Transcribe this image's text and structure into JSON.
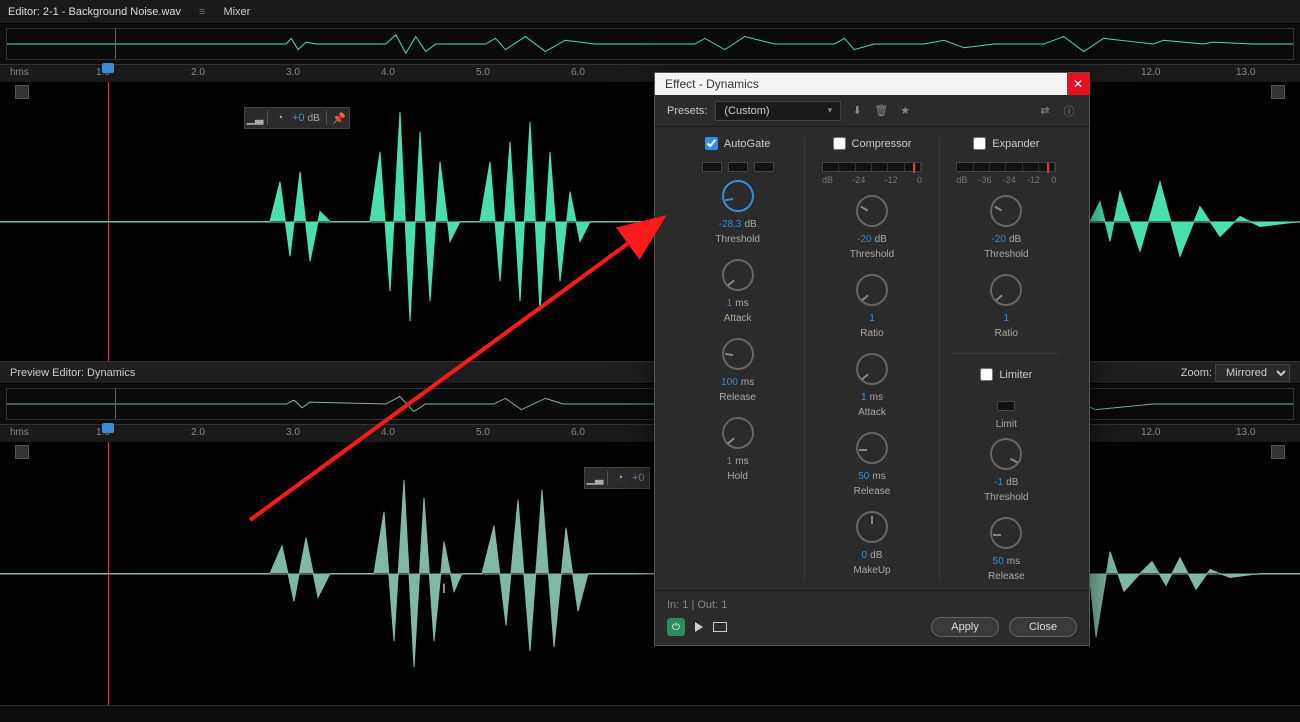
{
  "topbar": {
    "editor_label": "Editor: 2-1 - Background Noise.wav",
    "mixer_label": "Mixer"
  },
  "ruler_unit": "hms",
  "ruler_marks": [
    "1.0",
    "2.0",
    "3.0",
    "4.0",
    "5.0",
    "6.0",
    "12.0",
    "13.0"
  ],
  "gain": {
    "value": "+0",
    "unit": "dB"
  },
  "preview": {
    "title": "Preview Editor: Dynamics",
    "zoom_label": "Zoom:",
    "zoom_value": "Mirrored"
  },
  "dialog": {
    "title": "Effect - Dynamics",
    "presets_label": "Presets:",
    "presets_value": "(Custom)",
    "autogate": {
      "label": "AutoGate",
      "checked": true,
      "k1": {
        "val": "-28.3",
        "unit": "dB",
        "lbl": "Threshold"
      },
      "k2": {
        "val": "1",
        "unit": "ms",
        "lbl": "Attack"
      },
      "k3": {
        "val": "100",
        "unit": "ms",
        "lbl": "Release"
      },
      "k4": {
        "val": "1",
        "unit": "ms",
        "lbl": "Hold"
      }
    },
    "compressor": {
      "label": "Compressor",
      "checked": false,
      "scale": [
        "dB",
        "-24",
        "-12",
        "0"
      ],
      "k1": {
        "val": "-20",
        "unit": "dB",
        "lbl": "Threshold"
      },
      "k2": {
        "val": "1",
        "unit": "",
        "lbl": "Ratio"
      },
      "k3": {
        "val": "1",
        "unit": "ms",
        "lbl": "Attack"
      },
      "k4": {
        "val": "50",
        "unit": "ms",
        "lbl": "Release"
      },
      "k5": {
        "val": "0",
        "unit": "dB",
        "lbl": "MakeUp"
      }
    },
    "expander": {
      "label": "Expander",
      "checked": false,
      "scale": [
        "dB",
        "-36",
        "-24",
        "-12",
        "0"
      ],
      "k1": {
        "val": "-20",
        "unit": "dB",
        "lbl": "Threshold"
      },
      "k2": {
        "val": "1",
        "unit": "",
        "lbl": "Ratio"
      }
    },
    "limiter": {
      "label": "Limiter",
      "checked": false,
      "limit_label": "Limit",
      "k1": {
        "val": "-1",
        "unit": "dB",
        "lbl": "Threshold"
      },
      "k2": {
        "val": "50",
        "unit": "ms",
        "lbl": "Release"
      }
    },
    "io": "In: 1 | Out: 1",
    "apply": "Apply",
    "close": "Close"
  }
}
